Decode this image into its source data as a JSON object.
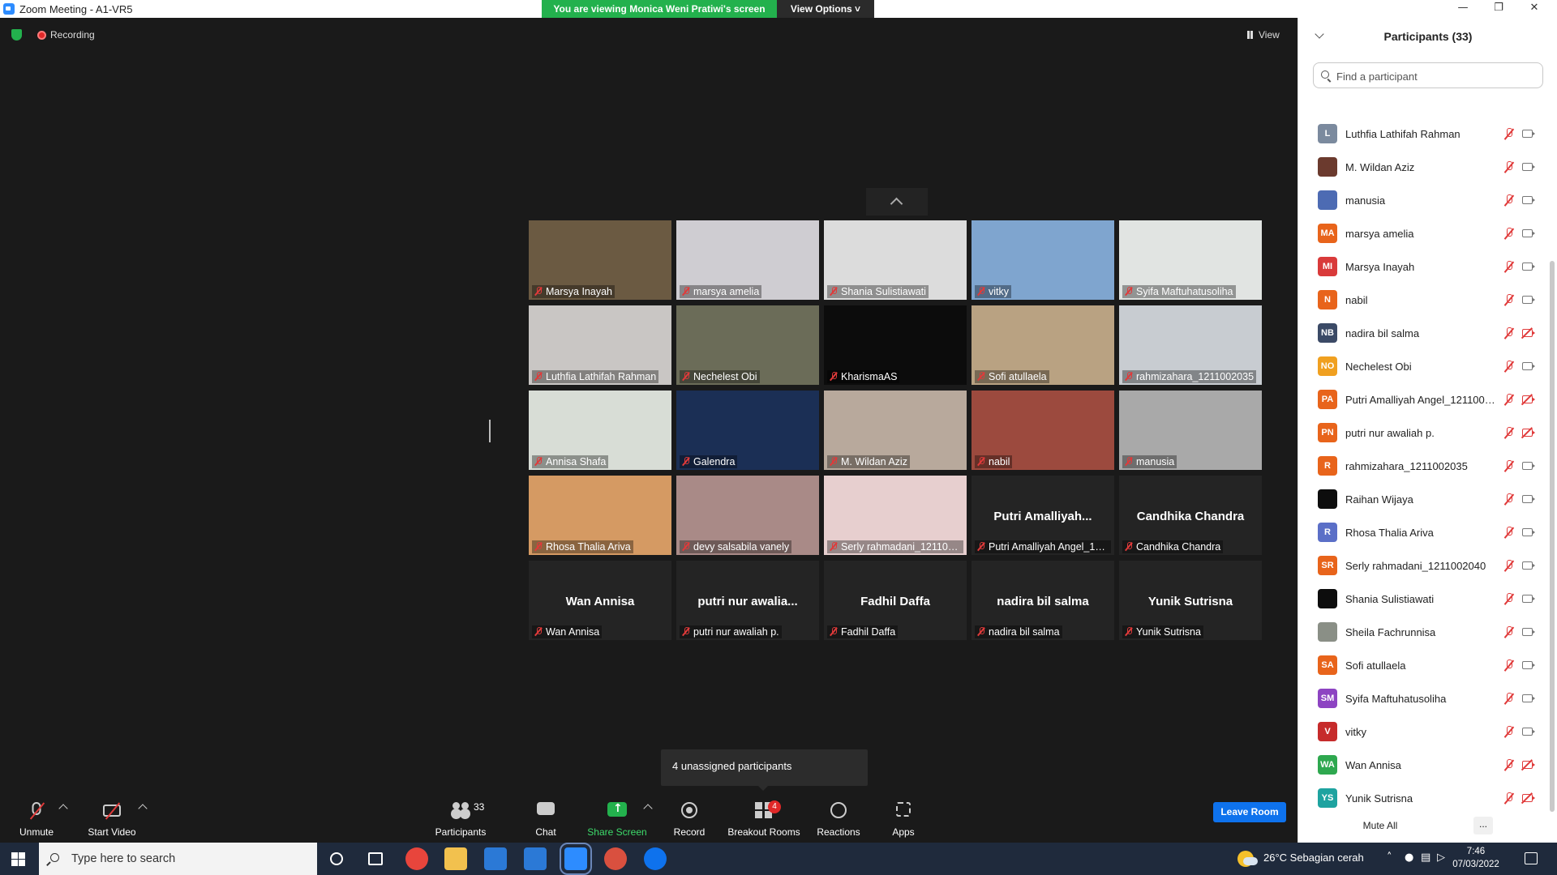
{
  "window": {
    "title": "Zoom Meeting - A1-VR5",
    "minimize": "—",
    "maximize": "❐",
    "close": "✕"
  },
  "banner": {
    "viewing_text": "You are viewing Monica Weni Pratiwi's screen",
    "view_options": "View Options ˅"
  },
  "meeting": {
    "recording_label": "Recording",
    "view_label": "View",
    "tooltip": "4 unassigned participants"
  },
  "tiles": [
    {
      "label": "Marsya Inayah",
      "big": "",
      "bg": "#6b5a42"
    },
    {
      "label": "marsya amelia",
      "big": "",
      "bg": "#cfcdd2"
    },
    {
      "label": "Shania Sulistiawati",
      "big": "",
      "bg": "#dcdcdc"
    },
    {
      "label": "vitky",
      "big": "",
      "bg": "#7fa5cf"
    },
    {
      "label": "Syifa Maftuhatusoliha",
      "big": "",
      "bg": "#e1e4e2"
    },
    {
      "label": "Luthfia Lathifah Rahman",
      "big": "",
      "bg": "#c9c6c4"
    },
    {
      "label": "Nechelest Obi",
      "big": "",
      "bg": "#6b6c58"
    },
    {
      "label": "KharismaAS",
      "big": "",
      "bg": "#0c0c0c"
    },
    {
      "label": "Sofi atullaela",
      "big": "",
      "bg": "#b9a282"
    },
    {
      "label": "rahmizahara_1211002035",
      "big": "",
      "bg": "#c8ccd1"
    },
    {
      "label": "Annisa Shafa",
      "big": "",
      "bg": "#d8ddd6"
    },
    {
      "label": "Galendra",
      "big": "",
      "bg": "#1b2f55"
    },
    {
      "label": "M. Wildan Aziz",
      "big": "",
      "bg": "#b8a99c"
    },
    {
      "label": "nabil",
      "big": "",
      "bg": "#9c4a3e"
    },
    {
      "label": "manusia",
      "big": "",
      "bg": "#a9a9a9"
    },
    {
      "label": "Rhosa Thalia Ariva",
      "big": "",
      "bg": "#d59a63"
    },
    {
      "label": "devy salsabila vanely",
      "big": "",
      "bg": "#a98a87"
    },
    {
      "label": "Serly rahmadani_1211002040",
      "big": "",
      "bg": "#e7cfcf"
    },
    {
      "label": "Putri Amalliyah Angel_1211002...",
      "big": "Putri  Amalliyah...",
      "bg": ""
    },
    {
      "label": "Candhika Chandra",
      "big": "Candhika Chandra",
      "bg": ""
    },
    {
      "label": "Wan Annisa",
      "big": "Wan Annisa",
      "bg": ""
    },
    {
      "label": "putri nur awaliah p.",
      "big": "putri  nur  awalia...",
      "bg": ""
    },
    {
      "label": "Fadhil Daffa",
      "big": "Fadhil Daffa",
      "bg": ""
    },
    {
      "label": "nadira bil salma",
      "big": "nadira bil salma",
      "bg": ""
    },
    {
      "label": "Yunik Sutrisna",
      "big": "Yunik Sutrisna",
      "bg": ""
    }
  ],
  "toolbar": {
    "unmute": "Unmute",
    "start_video": "Start Video",
    "participants": "Participants",
    "participants_count": "33",
    "chat": "Chat",
    "share_screen": "Share Screen",
    "record": "Record",
    "breakout_rooms": "Breakout Rooms",
    "breakout_badge": "4",
    "reactions": "Reactions",
    "apps": "Apps",
    "leave_room": "Leave Room"
  },
  "panel": {
    "title": "Participants (33)",
    "search_placeholder": "Find a participant",
    "mute_all": "Mute All",
    "more": "...",
    "participants": [
      {
        "initials": "L",
        "name": "Luthfia Lathifah Rahman",
        "color": "#7b8a9e",
        "video_off": false
      },
      {
        "initials": "",
        "name": "M. Wildan Aziz",
        "color": "#6b3a2e",
        "video_off": false
      },
      {
        "initials": "",
        "name": "manusia",
        "color": "#4d6bb3",
        "video_off": false
      },
      {
        "initials": "MA",
        "name": "marsya amelia",
        "color": "#e8641b",
        "video_off": false
      },
      {
        "initials": "MI",
        "name": "Marsya Inayah",
        "color": "#d93a3a",
        "video_off": false
      },
      {
        "initials": "N",
        "name": "nabil",
        "color": "#e8641b",
        "video_off": false
      },
      {
        "initials": "NB",
        "name": "nadira bil salma",
        "color": "#3b4a66",
        "video_off": true
      },
      {
        "initials": "NO",
        "name": "Nechelest Obi",
        "color": "#f0a020",
        "video_off": false
      },
      {
        "initials": "PA",
        "name": "Putri Amalliyah Angel_1211002...",
        "color": "#e8641b",
        "video_off": true
      },
      {
        "initials": "PN",
        "name": "putri nur awaliah p.",
        "color": "#e8641b",
        "video_off": true
      },
      {
        "initials": "R",
        "name": "rahmizahara_1211002035",
        "color": "#e8641b",
        "video_off": false
      },
      {
        "initials": "",
        "name": "Raihan Wijaya",
        "color": "#0d0d0d",
        "video_off": false
      },
      {
        "initials": "R",
        "name": "Rhosa Thalia Ariva",
        "color": "#5b6fc7",
        "video_off": false
      },
      {
        "initials": "SR",
        "name": "Serly rahmadani_1211002040",
        "color": "#e8641b",
        "video_off": false
      },
      {
        "initials": "",
        "name": "Shania Sulistiawati",
        "color": "#0d0d0d",
        "video_off": false
      },
      {
        "initials": "",
        "name": "Sheila Fachrunnisa",
        "color": "#8a8f86",
        "video_off": false
      },
      {
        "initials": "SA",
        "name": "Sofi atullaela",
        "color": "#e8641b",
        "video_off": false
      },
      {
        "initials": "SM",
        "name": "Syifa Maftuhatusoliha",
        "color": "#8d44c2",
        "video_off": false
      },
      {
        "initials": "V",
        "name": "vitky",
        "color": "#c62b2b",
        "video_off": false
      },
      {
        "initials": "WA",
        "name": "Wan Annisa",
        "color": "#2ea84f",
        "video_off": true
      },
      {
        "initials": "YS",
        "name": "Yunik Sutrisna",
        "color": "#1ea3a0",
        "video_off": true
      }
    ]
  },
  "taskbar": {
    "search_text": "Type here to search",
    "weather": "26°C  Sebagian cerah",
    "time": "7:46",
    "date": "07/03/2022",
    "apps": [
      {
        "name": "chrome",
        "color": "#e8453c"
      },
      {
        "name": "file-explorer",
        "color": "#f2c14e"
      },
      {
        "name": "store",
        "color": "#2b79d6"
      },
      {
        "name": "mail",
        "color": "#2b79d6"
      },
      {
        "name": "zoom",
        "color": "#2d8cff"
      },
      {
        "name": "chrome-profile",
        "color": "#d9503f"
      },
      {
        "name": "teamviewer",
        "color": "#0e72ed"
      }
    ]
  }
}
